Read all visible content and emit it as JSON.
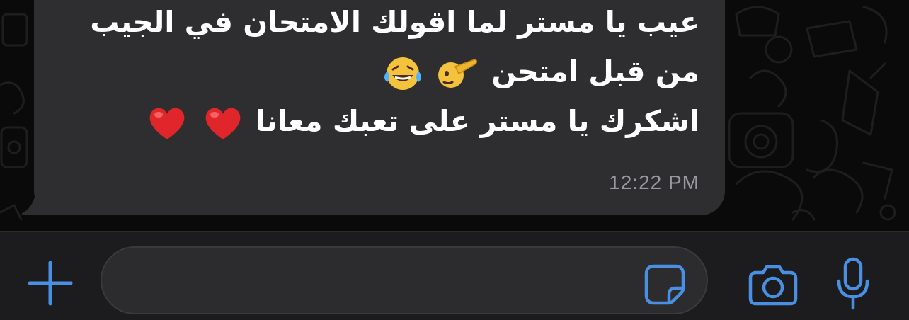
{
  "message": {
    "lines": [
      "عيب يا مستر لما اقولك الامتحان في الجيب",
      "من قبل امتحن",
      "اشكرك يا مستر على تعبك معانا"
    ],
    "emojis": {
      "line2": [
        "saluting-face-emoji",
        "laughing-tears-emoji"
      ],
      "line3": [
        "red-heart-emoji",
        "red-heart-emoji"
      ]
    },
    "time": "12:22 PM"
  },
  "composer": {
    "placeholder": "",
    "value": "",
    "icons": [
      "plus-icon",
      "sticker-icon",
      "camera-icon",
      "microphone-icon"
    ]
  },
  "colors": {
    "background": "#0b0b0b",
    "bubble": "#2e2e30",
    "input_bar": "#1c1c1e",
    "accent": "#4a90e2",
    "timestamp": "#9a9a9e",
    "text": "#ffffff"
  }
}
